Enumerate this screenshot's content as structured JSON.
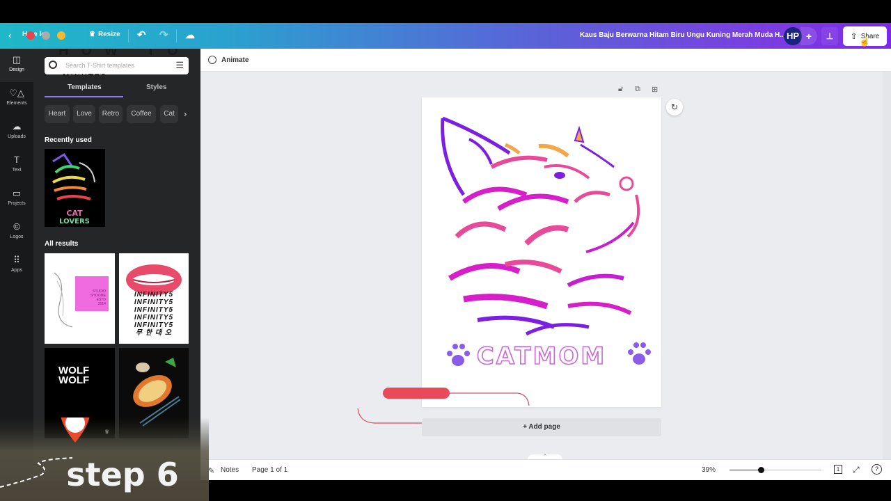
{
  "topbar": {
    "back_label": "Home",
    "home_label_partial": "Ho  e  le",
    "resize_label": "Resize",
    "document_title": "Kaus Baju Berwarna Hitam Biru Ungu Kuning Merah Muda H...",
    "avatar_initials": "HP",
    "share_label": "Share"
  },
  "rail": {
    "items": [
      {
        "label": "Design",
        "icon": "design-icon",
        "glyph": "◫"
      },
      {
        "label": "Elements",
        "icon": "elements-icon",
        "glyph": "♡△"
      },
      {
        "label": "Uploads",
        "icon": "upload-cloud-icon",
        "glyph": "☁"
      },
      {
        "label": "Text",
        "icon": "text-icon",
        "glyph": "T"
      },
      {
        "label": "Projects",
        "icon": "folder-icon",
        "glyph": "▭"
      },
      {
        "label": "Logos",
        "icon": "logo-icon",
        "glyph": "©"
      },
      {
        "label": "Apps",
        "icon": "apps-grid-icon",
        "glyph": "⠿"
      }
    ]
  },
  "panel": {
    "search_placeholder": "Search T-Shirt templates",
    "overlay_how_to": "HOW TO",
    "overlay_minutes": "MINUTES",
    "tabs": [
      {
        "label": "Templates",
        "active": true
      },
      {
        "label": "Styles",
        "active": false
      }
    ],
    "chips": [
      "Heart",
      "Love",
      "Retro",
      "Coffee",
      "Cat"
    ],
    "recently_used_label": "Recently used",
    "recent_thumb": {
      "line1": "CAT",
      "line2": "LOVERS"
    },
    "all_results_label": "All results",
    "results": [
      {
        "name": "studio-tiger-template",
        "text": [
          "STUDIO",
          "SHOOME",
          "ESTD",
          "2014"
        ]
      },
      {
        "name": "infinity5-lips-template",
        "text": [
          "INFINITY5",
          "INFINITY5",
          "INFINITY5",
          "INFINITY5",
          "INFINITY5",
          "무 한 대 오"
        ]
      },
      {
        "name": "wolf-template",
        "text": [
          "WOLF",
          "WOLF"
        ]
      },
      {
        "name": "food-template",
        "text": []
      }
    ]
  },
  "canvas": {
    "animate_label": "Animate",
    "design_text": "CATMOM",
    "add_page_label": "+ Add page",
    "colors": {
      "purple": "#7b1fe0",
      "magenta": "#d61fc8",
      "pink": "#e84a9a",
      "orange": "#f2a84a",
      "paw": "#8a5ce8",
      "text": "#c86ad8"
    }
  },
  "bottombar": {
    "notes_label": "Notes",
    "page_indicator": "Page 1 of 1",
    "zoom_level": "39%",
    "zoom_fraction": 0.34,
    "page_count": "1"
  },
  "video_overlay": {
    "step_label": "step 6"
  }
}
